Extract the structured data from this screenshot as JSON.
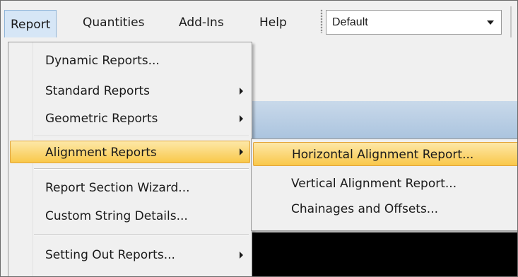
{
  "menubar": {
    "items": [
      {
        "label": "Report",
        "open": true
      },
      {
        "label": "Quantities"
      },
      {
        "label": "Add-Ins"
      },
      {
        "label": "Help"
      }
    ],
    "combo_value": "Default"
  },
  "report_menu": {
    "items": [
      {
        "label": "Dynamic Reports...",
        "has_submenu": false
      },
      {
        "label": "Standard Reports",
        "has_submenu": true
      },
      {
        "label": "Geometric Reports",
        "has_submenu": true
      },
      {
        "label": "Alignment Reports",
        "has_submenu": true,
        "highlighted": true
      },
      {
        "label": "Report Section Wizard...",
        "has_submenu": false
      },
      {
        "label": "Custom String Details...",
        "has_submenu": false
      },
      {
        "label": "Setting Out Reports...",
        "has_submenu": true
      }
    ]
  },
  "alignment_submenu": {
    "items": [
      {
        "label": "Horizontal Alignment Report...",
        "highlighted": true
      },
      {
        "label": "Vertical Alignment Report..."
      },
      {
        "label": "Chainages and Offsets..."
      }
    ]
  },
  "colors": {
    "highlight": "#f9c84a",
    "menu_background": "#f0f0f0",
    "open_menu_title": "#d6e6f6"
  }
}
